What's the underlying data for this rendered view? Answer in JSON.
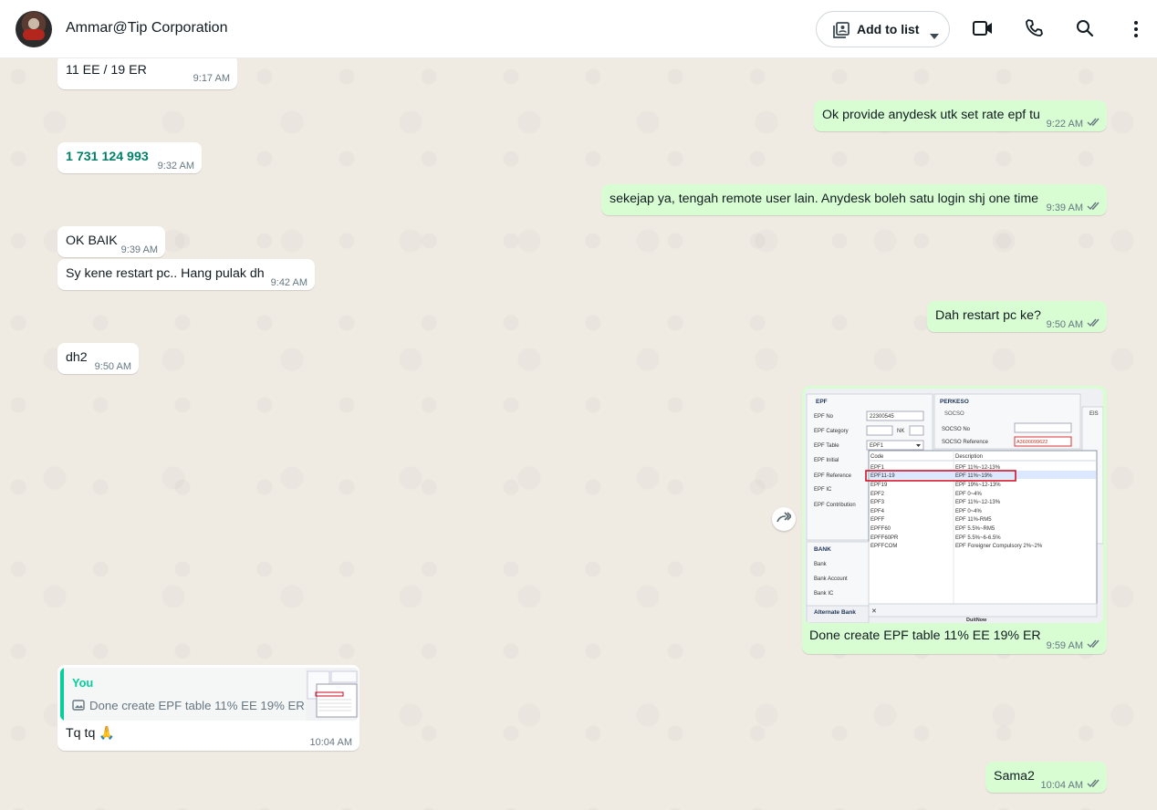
{
  "header": {
    "title": "Ammar@Tip Corporation",
    "add_to_list": "Add to list",
    "icons": [
      "video-call-icon",
      "voice-call-icon",
      "search-icon",
      "menu-icon"
    ]
  },
  "messages": [
    {
      "dir": "in",
      "text": "11 EE / 19 ER",
      "time": "9:17 AM"
    },
    {
      "dir": "out",
      "text": "Ok provide anydesk utk set rate epf tu",
      "time": "9:22 AM"
    },
    {
      "dir": "in",
      "text": "1 731 124 993",
      "time": "9:32 AM"
    },
    {
      "dir": "out",
      "text": "sekejap ya, tengah remote user lain. Anydesk boleh satu login shj one time",
      "time": "9:39 AM"
    },
    {
      "dir": "in",
      "text": "OK BAIK",
      "time": "9:39 AM"
    },
    {
      "dir": "in",
      "text": "Sy kene restart pc.. Hang pulak dh",
      "time": "9:42 AM"
    },
    {
      "dir": "out",
      "text": "Dah restart pc ke?",
      "time": "9:50 AM"
    },
    {
      "dir": "in",
      "text": "dh2",
      "time": "9:50 AM"
    },
    {
      "dir": "out",
      "caption": "Done create EPF table 11% EE 19% ER",
      "time": "9:59 AM"
    },
    {
      "dir": "in",
      "quote_author": "You",
      "quote_text": "Done create EPF table 11% EE 19% ER",
      "text": "Tq tq",
      "emoji": "🙏",
      "time": "10:04 AM"
    },
    {
      "dir": "out",
      "text": "Sama2",
      "time": "10:04 AM"
    }
  ],
  "screenshot": {
    "epf_header": "EPF",
    "perkeso_header": "PERKESO",
    "socso_label": "SOCSO",
    "eis_label": "EIS",
    "labels": [
      "EPF No",
      "EPF Category",
      "EPF Table",
      "EPF Initial",
      "EPF Reference",
      "EPF IC",
      "EPF Contribution"
    ],
    "epf_no": "22300545",
    "nk": "NK",
    "epf_table_value": "EPF1",
    "socso_no": "SOCSO No",
    "socso_ref": "SOCSO Reference",
    "socso_ref_value": "A3600099622",
    "col_code": "Code",
    "col_desc": "Description",
    "rows": [
      [
        "EPF1",
        "EPF 11%~12-13%"
      ],
      [
        "EPF11-19",
        "EPF 11%~19%"
      ],
      [
        "EPF19",
        "EPF 19%~12-13%"
      ],
      [
        "EPF2",
        "EPF 0~4%"
      ],
      [
        "EPF3",
        "EPF 11%~12-13%"
      ],
      [
        "EPF4",
        "EPF 0~4%"
      ],
      [
        "EPFF",
        "EPF 11%-RM5"
      ],
      [
        "EPFF60",
        "EPF 5.5%~RM5"
      ],
      [
        "EPFF60PR",
        "EPF 5.5%~6-6.5%"
      ],
      [
        "EPFFCOM",
        "EPF Foreigner Compulsory 2%~2%"
      ]
    ],
    "bank_header": "BANK",
    "bank_labels": [
      "Bank",
      "Bank Account",
      "Bank IC"
    ],
    "alt_bank": "Alternate Bank",
    "close_mark": "✕",
    "duitnow": "DuitNow"
  },
  "colors": {
    "incoming": "#ffffff",
    "outgoing": "#d9fdd3",
    "accent": "#008069",
    "tick": "#667781"
  }
}
